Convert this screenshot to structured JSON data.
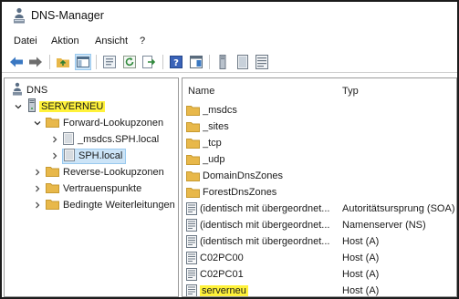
{
  "window": {
    "title": "DNS-Manager"
  },
  "menu": [
    "Datei",
    "Aktion",
    "Ansicht",
    "?"
  ],
  "toolbar": {
    "icons": [
      "back-arrow-icon",
      "forward-arrow-icon",
      "folder-up-icon",
      "console-tree-icon",
      "properties-icon",
      "refresh-icon",
      "export-icon",
      "help-icon",
      "details-view-icon",
      "server-icon",
      "zone-icon",
      "record-icon"
    ]
  },
  "tree": {
    "root": "DNS",
    "server": "SERVERNEU",
    "forward": "Forward-Lookupzonen",
    "msdcs_zone": "_msdcs.SPH.local",
    "sph_zone": "SPH.local",
    "reverse": "Reverse-Lookupzonen",
    "trust": "Vertrauenspunkte",
    "conditional": "Bedingte Weiterleitungen"
  },
  "list": {
    "col_name": "Name",
    "col_type": "Typ",
    "rows": [
      {
        "name": "_msdcs",
        "type": "",
        "icon": "folder-icon"
      },
      {
        "name": "_sites",
        "type": "",
        "icon": "folder-icon"
      },
      {
        "name": "_tcp",
        "type": "",
        "icon": "folder-icon"
      },
      {
        "name": "_udp",
        "type": "",
        "icon": "folder-icon"
      },
      {
        "name": "DomainDnsZones",
        "type": "",
        "icon": "folder-icon"
      },
      {
        "name": "ForestDnsZones",
        "type": "",
        "icon": "folder-icon"
      },
      {
        "name": "(identisch mit übergeordnet...",
        "type": "Autoritätsursprung (SOA)",
        "icon": "record-icon"
      },
      {
        "name": "(identisch mit übergeordnet...",
        "type": "Namenserver (NS)",
        "icon": "record-icon"
      },
      {
        "name": "(identisch mit übergeordnet...",
        "type": "Host (A)",
        "icon": "record-icon"
      },
      {
        "name": "C02PC00",
        "type": "Host (A)",
        "icon": "record-icon"
      },
      {
        "name": "C02PC01",
        "type": "Host (A)",
        "icon": "record-icon"
      },
      {
        "name": "serverneu",
        "type": "Host (A)",
        "icon": "record-icon"
      }
    ]
  },
  "colors": {
    "highlight": "#fff23a",
    "selection": "#cce4f7",
    "folder": "#e8b84a"
  }
}
